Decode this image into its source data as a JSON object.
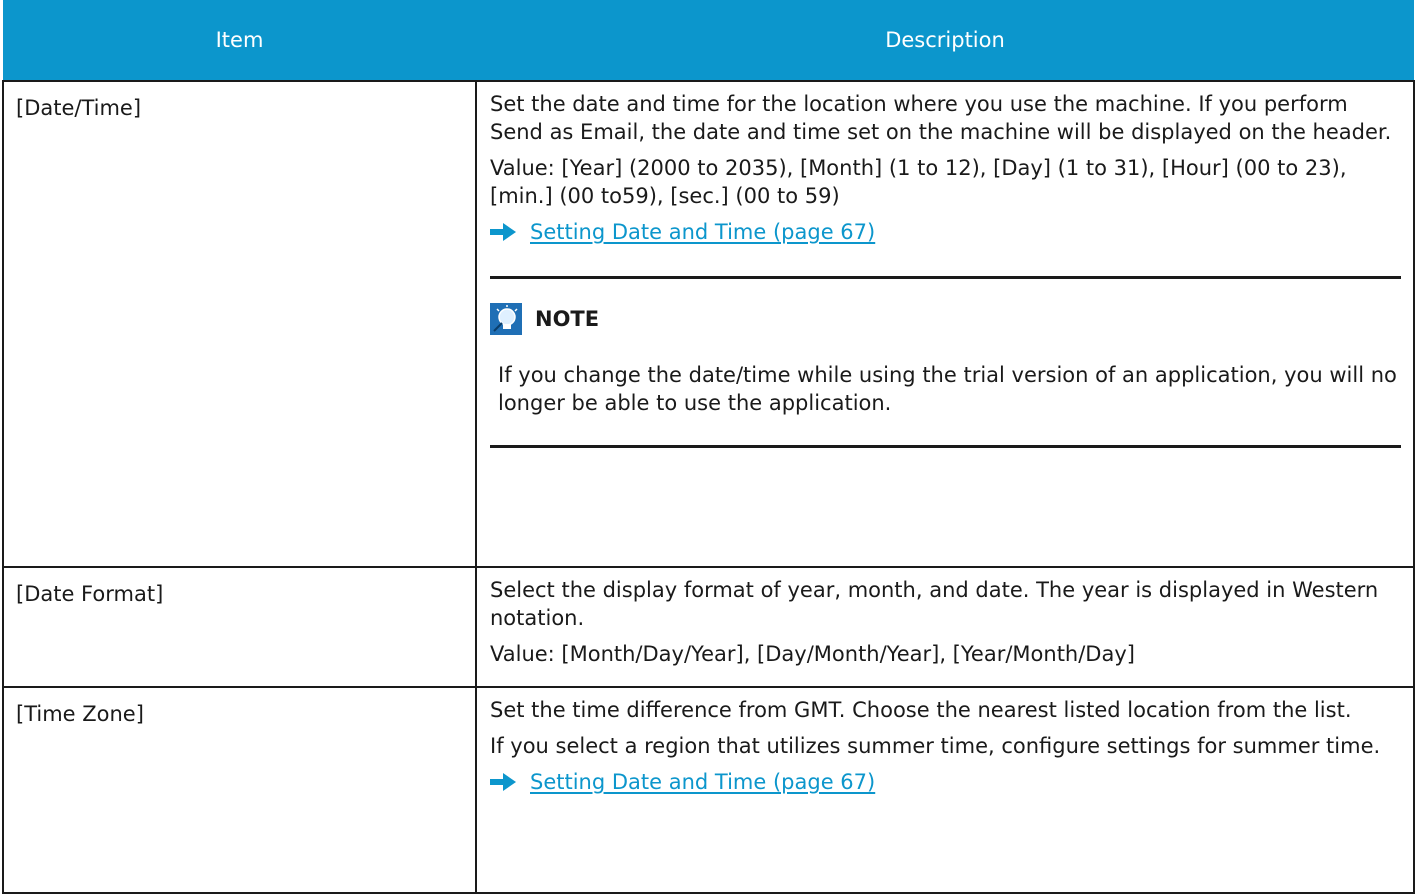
{
  "table": {
    "headers": {
      "item": "Item",
      "description": "Description"
    },
    "rows": [
      {
        "item": "[Date/Time]",
        "paragraphs": [
          "Set the date and time for the location where you use the machine. If you perform Send as Email, the date and time set on the machine will be displayed on the header.",
          "Value: [Year] (2000 to 2035), [Month] (1 to 12), [Day] (1 to 31), [Hour] (00 to 23), [min.] (00 to59), [sec.] (00 to 59)"
        ],
        "link": "Setting Date and Time (page 67)",
        "note": {
          "title": "NOTE",
          "text": "If you change the date/time while using the trial version of an application, you will no longer be able to use the application."
        }
      },
      {
        "item": "[Date Format]",
        "paragraphs": [
          "Select the display format of year, month, and date. The year is displayed in Western notation.",
          "Value: [Month/Day/Year], [Day/Month/Year], [Year/Month/Day]"
        ]
      },
      {
        "item": "[Time Zone]",
        "paragraphs": [
          "Set the time difference from GMT. Choose the nearest listed location from the list.",
          "If you select a region that utilizes summer time, configure settings for summer time."
        ],
        "link": "Setting Date and Time (page 67)"
      }
    ]
  },
  "icons": {
    "link_arrow": "right-arrow-icon",
    "note": "lightbulb-note-icon"
  },
  "colors": {
    "header_bg": "#0c96cc",
    "link": "#0c96cc",
    "note_icon": "#1f6fb5"
  }
}
